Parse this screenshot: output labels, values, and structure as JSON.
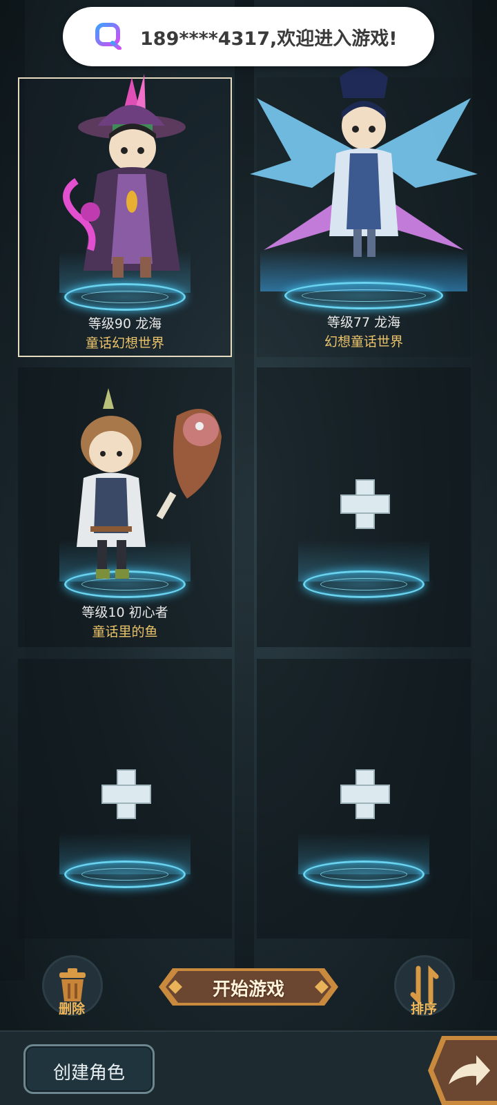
{
  "toast": {
    "message": "189****4317,欢迎进入游戏!"
  },
  "slots": [
    {
      "level": "等级90  龙海",
      "server": "童话幻想世界"
    },
    {
      "level": "等级77  龙海",
      "server": "幻想童话世界"
    },
    {
      "level": "等级10  初心者",
      "server": "童话里的鱼"
    }
  ],
  "controls": {
    "delete_label": "删除",
    "start_label": "开始游戏",
    "sort_label": "排序",
    "create_label": "创建角色"
  },
  "colors": {
    "accent_gold": "#ebc36b",
    "pad_blue": "#6ad3ef",
    "brown_button": "#6b4630"
  }
}
